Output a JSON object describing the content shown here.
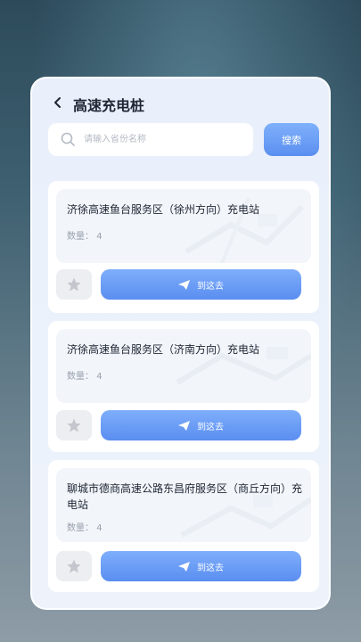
{
  "header": {
    "title": "高速充电桩"
  },
  "search": {
    "placeholder": "请输入省份名称",
    "button_label": "搜索"
  },
  "stations": [
    {
      "name": "济徐高速鱼台服务区（徐州方向）充电站",
      "count_label": "数量：",
      "count": "4",
      "go_label": "到这去"
    },
    {
      "name": "济徐高速鱼台服务区（济南方向）充电站",
      "count_label": "数量：",
      "count": "4",
      "go_label": "到这去"
    },
    {
      "name": "聊城市德商高速公路东昌府服务区（商丘方向）充电站",
      "count_label": "数量：",
      "count": "4",
      "go_label": "到这去"
    }
  ],
  "colors": {
    "accent": "#5b8ff0",
    "title": "#1e2633",
    "muted": "#9aa2ad"
  }
}
